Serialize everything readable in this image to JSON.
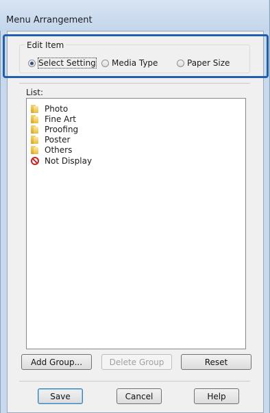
{
  "window": {
    "title": "Menu Arrangement"
  },
  "edit_item": {
    "legend": "Edit Item",
    "options": [
      {
        "label": "Select Setting",
        "selected": true
      },
      {
        "label": "Media Type",
        "selected": false
      },
      {
        "label": "Paper Size",
        "selected": false
      }
    ]
  },
  "list": {
    "label": "List:",
    "items": [
      {
        "label": "Photo",
        "icon": "folder-icon"
      },
      {
        "label": "Fine Art",
        "icon": "folder-icon"
      },
      {
        "label": "Proofing",
        "icon": "folder-icon"
      },
      {
        "label": "Poster",
        "icon": "folder-icon"
      },
      {
        "label": "Others",
        "icon": "folder-icon"
      },
      {
        "label": "Not Display",
        "icon": "no-display-icon"
      }
    ]
  },
  "actions": {
    "add_group": "Add Group...",
    "delete_group": "Delete Group",
    "reset": "Reset"
  },
  "footer": {
    "save": "Save",
    "cancel": "Cancel",
    "help": "Help"
  },
  "colors": {
    "callout": "#1f5fae",
    "radio_selected": "#2b4f86"
  }
}
